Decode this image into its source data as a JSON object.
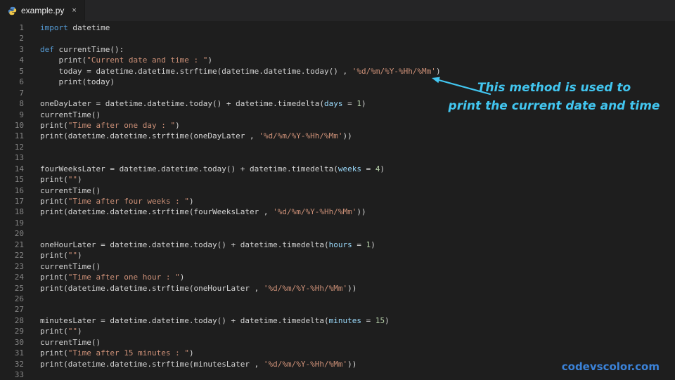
{
  "tab": {
    "label": "example.py",
    "icon": "python-icon",
    "close_glyph": "×"
  },
  "colors": {
    "editorBg": "#1e1e1e",
    "tabBarBg": "#252526",
    "tabBg": "#1e1e1e",
    "tabText": "#e8e8e8",
    "lineNumber": "#858585",
    "plain": "#d4d4d4",
    "keyword": "#569cd6",
    "string": "#ce9178",
    "number": "#b5cea8",
    "param": "#9cdcfe",
    "annotation": "#42c6f0",
    "watermark": "#3b82d8"
  },
  "annotation": {
    "line1": "This method is used to",
    "line2": "print the current date and time"
  },
  "watermark": "codevscolor.com",
  "editor": {
    "lines": [
      {
        "num": 1,
        "segments": [
          {
            "t": "import",
            "c": "keyword"
          },
          {
            "t": " datetime",
            "c": "plain"
          }
        ]
      },
      {
        "num": 2,
        "segments": []
      },
      {
        "num": 3,
        "segments": [
          {
            "t": "def",
            "c": "keyword"
          },
          {
            "t": " currentTime():",
            "c": "plain"
          }
        ]
      },
      {
        "num": 4,
        "segments": [
          {
            "t": "    print(",
            "c": "plain"
          },
          {
            "t": "\"Current date and time : \"",
            "c": "string"
          },
          {
            "t": ")",
            "c": "plain"
          }
        ]
      },
      {
        "num": 5,
        "segments": [
          {
            "t": "    today = datetime.datetime.strftime(datetime.datetime.today() , ",
            "c": "plain"
          },
          {
            "t": "'%d/%m/%Y-%Hh/%Mm'",
            "c": "string"
          },
          {
            "t": ")",
            "c": "plain"
          }
        ]
      },
      {
        "num": 6,
        "segments": [
          {
            "t": "    print(today)",
            "c": "plain"
          }
        ]
      },
      {
        "num": 7,
        "segments": []
      },
      {
        "num": 8,
        "segments": [
          {
            "t": "oneDayLater = datetime.datetime.today() + datetime.timedelta(",
            "c": "plain"
          },
          {
            "t": "days",
            "c": "param"
          },
          {
            "t": " = ",
            "c": "plain"
          },
          {
            "t": "1",
            "c": "number"
          },
          {
            "t": ")",
            "c": "plain"
          }
        ]
      },
      {
        "num": 9,
        "segments": [
          {
            "t": "currentTime()",
            "c": "plain"
          }
        ]
      },
      {
        "num": 10,
        "segments": [
          {
            "t": "print(",
            "c": "plain"
          },
          {
            "t": "\"Time after one day : \"",
            "c": "string"
          },
          {
            "t": ")",
            "c": "plain"
          }
        ]
      },
      {
        "num": 11,
        "segments": [
          {
            "t": "print(datetime.datetime.strftime(oneDayLater , ",
            "c": "plain"
          },
          {
            "t": "'%d/%m/%Y-%Hh/%Mm'",
            "c": "string"
          },
          {
            "t": "))",
            "c": "plain"
          }
        ]
      },
      {
        "num": 12,
        "segments": []
      },
      {
        "num": 13,
        "segments": []
      },
      {
        "num": 14,
        "segments": [
          {
            "t": "fourWeeksLater = datetime.datetime.today() + datetime.timedelta(",
            "c": "plain"
          },
          {
            "t": "weeks",
            "c": "param"
          },
          {
            "t": " = ",
            "c": "plain"
          },
          {
            "t": "4",
            "c": "number"
          },
          {
            "t": ")",
            "c": "plain"
          }
        ]
      },
      {
        "num": 15,
        "segments": [
          {
            "t": "print(",
            "c": "plain"
          },
          {
            "t": "\"\"",
            "c": "string"
          },
          {
            "t": ")",
            "c": "plain"
          }
        ]
      },
      {
        "num": 16,
        "segments": [
          {
            "t": "currentTime()",
            "c": "plain"
          }
        ]
      },
      {
        "num": 17,
        "segments": [
          {
            "t": "print(",
            "c": "plain"
          },
          {
            "t": "\"Time after four weeks : \"",
            "c": "string"
          },
          {
            "t": ")",
            "c": "plain"
          }
        ]
      },
      {
        "num": 18,
        "segments": [
          {
            "t": "print(datetime.datetime.strftime(fourWeeksLater , ",
            "c": "plain"
          },
          {
            "t": "'%d/%m/%Y-%Hh/%Mm'",
            "c": "string"
          },
          {
            "t": "))",
            "c": "plain"
          }
        ]
      },
      {
        "num": 19,
        "segments": []
      },
      {
        "num": 20,
        "segments": []
      },
      {
        "num": 21,
        "segments": [
          {
            "t": "oneHourLater = datetime.datetime.today() + datetime.timedelta(",
            "c": "plain"
          },
          {
            "t": "hours",
            "c": "param"
          },
          {
            "t": " = ",
            "c": "plain"
          },
          {
            "t": "1",
            "c": "number"
          },
          {
            "t": ")",
            "c": "plain"
          }
        ]
      },
      {
        "num": 22,
        "segments": [
          {
            "t": "print(",
            "c": "plain"
          },
          {
            "t": "\"\"",
            "c": "string"
          },
          {
            "t": ")",
            "c": "plain"
          }
        ]
      },
      {
        "num": 23,
        "segments": [
          {
            "t": "currentTime()",
            "c": "plain"
          }
        ]
      },
      {
        "num": 24,
        "segments": [
          {
            "t": "print(",
            "c": "plain"
          },
          {
            "t": "\"Time after one hour : \"",
            "c": "string"
          },
          {
            "t": ")",
            "c": "plain"
          }
        ]
      },
      {
        "num": 25,
        "segments": [
          {
            "t": "print(datetime.datetime.strftime(oneHourLater , ",
            "c": "plain"
          },
          {
            "t": "'%d/%m/%Y-%Hh/%Mm'",
            "c": "string"
          },
          {
            "t": "))",
            "c": "plain"
          }
        ]
      },
      {
        "num": 26,
        "segments": []
      },
      {
        "num": 27,
        "segments": []
      },
      {
        "num": 28,
        "segments": [
          {
            "t": "minutesLater = datetime.datetime.today() + datetime.timedelta(",
            "c": "plain"
          },
          {
            "t": "minutes",
            "c": "param"
          },
          {
            "t": " = ",
            "c": "plain"
          },
          {
            "t": "15",
            "c": "number"
          },
          {
            "t": ")",
            "c": "plain"
          }
        ]
      },
      {
        "num": 29,
        "segments": [
          {
            "t": "print(",
            "c": "plain"
          },
          {
            "t": "\"\"",
            "c": "string"
          },
          {
            "t": ")",
            "c": "plain"
          }
        ]
      },
      {
        "num": 30,
        "segments": [
          {
            "t": "currentTime()",
            "c": "plain"
          }
        ]
      },
      {
        "num": 31,
        "segments": [
          {
            "t": "print(",
            "c": "plain"
          },
          {
            "t": "\"Time after 15 minutes : \"",
            "c": "string"
          },
          {
            "t": ")",
            "c": "plain"
          }
        ]
      },
      {
        "num": 32,
        "segments": [
          {
            "t": "print(datetime.datetime.strftime(minutesLater , ",
            "c": "plain"
          },
          {
            "t": "'%d/%m/%Y-%Hh/%Mm'",
            "c": "string"
          },
          {
            "t": "))",
            "c": "plain"
          }
        ]
      },
      {
        "num": 33,
        "segments": []
      }
    ]
  }
}
